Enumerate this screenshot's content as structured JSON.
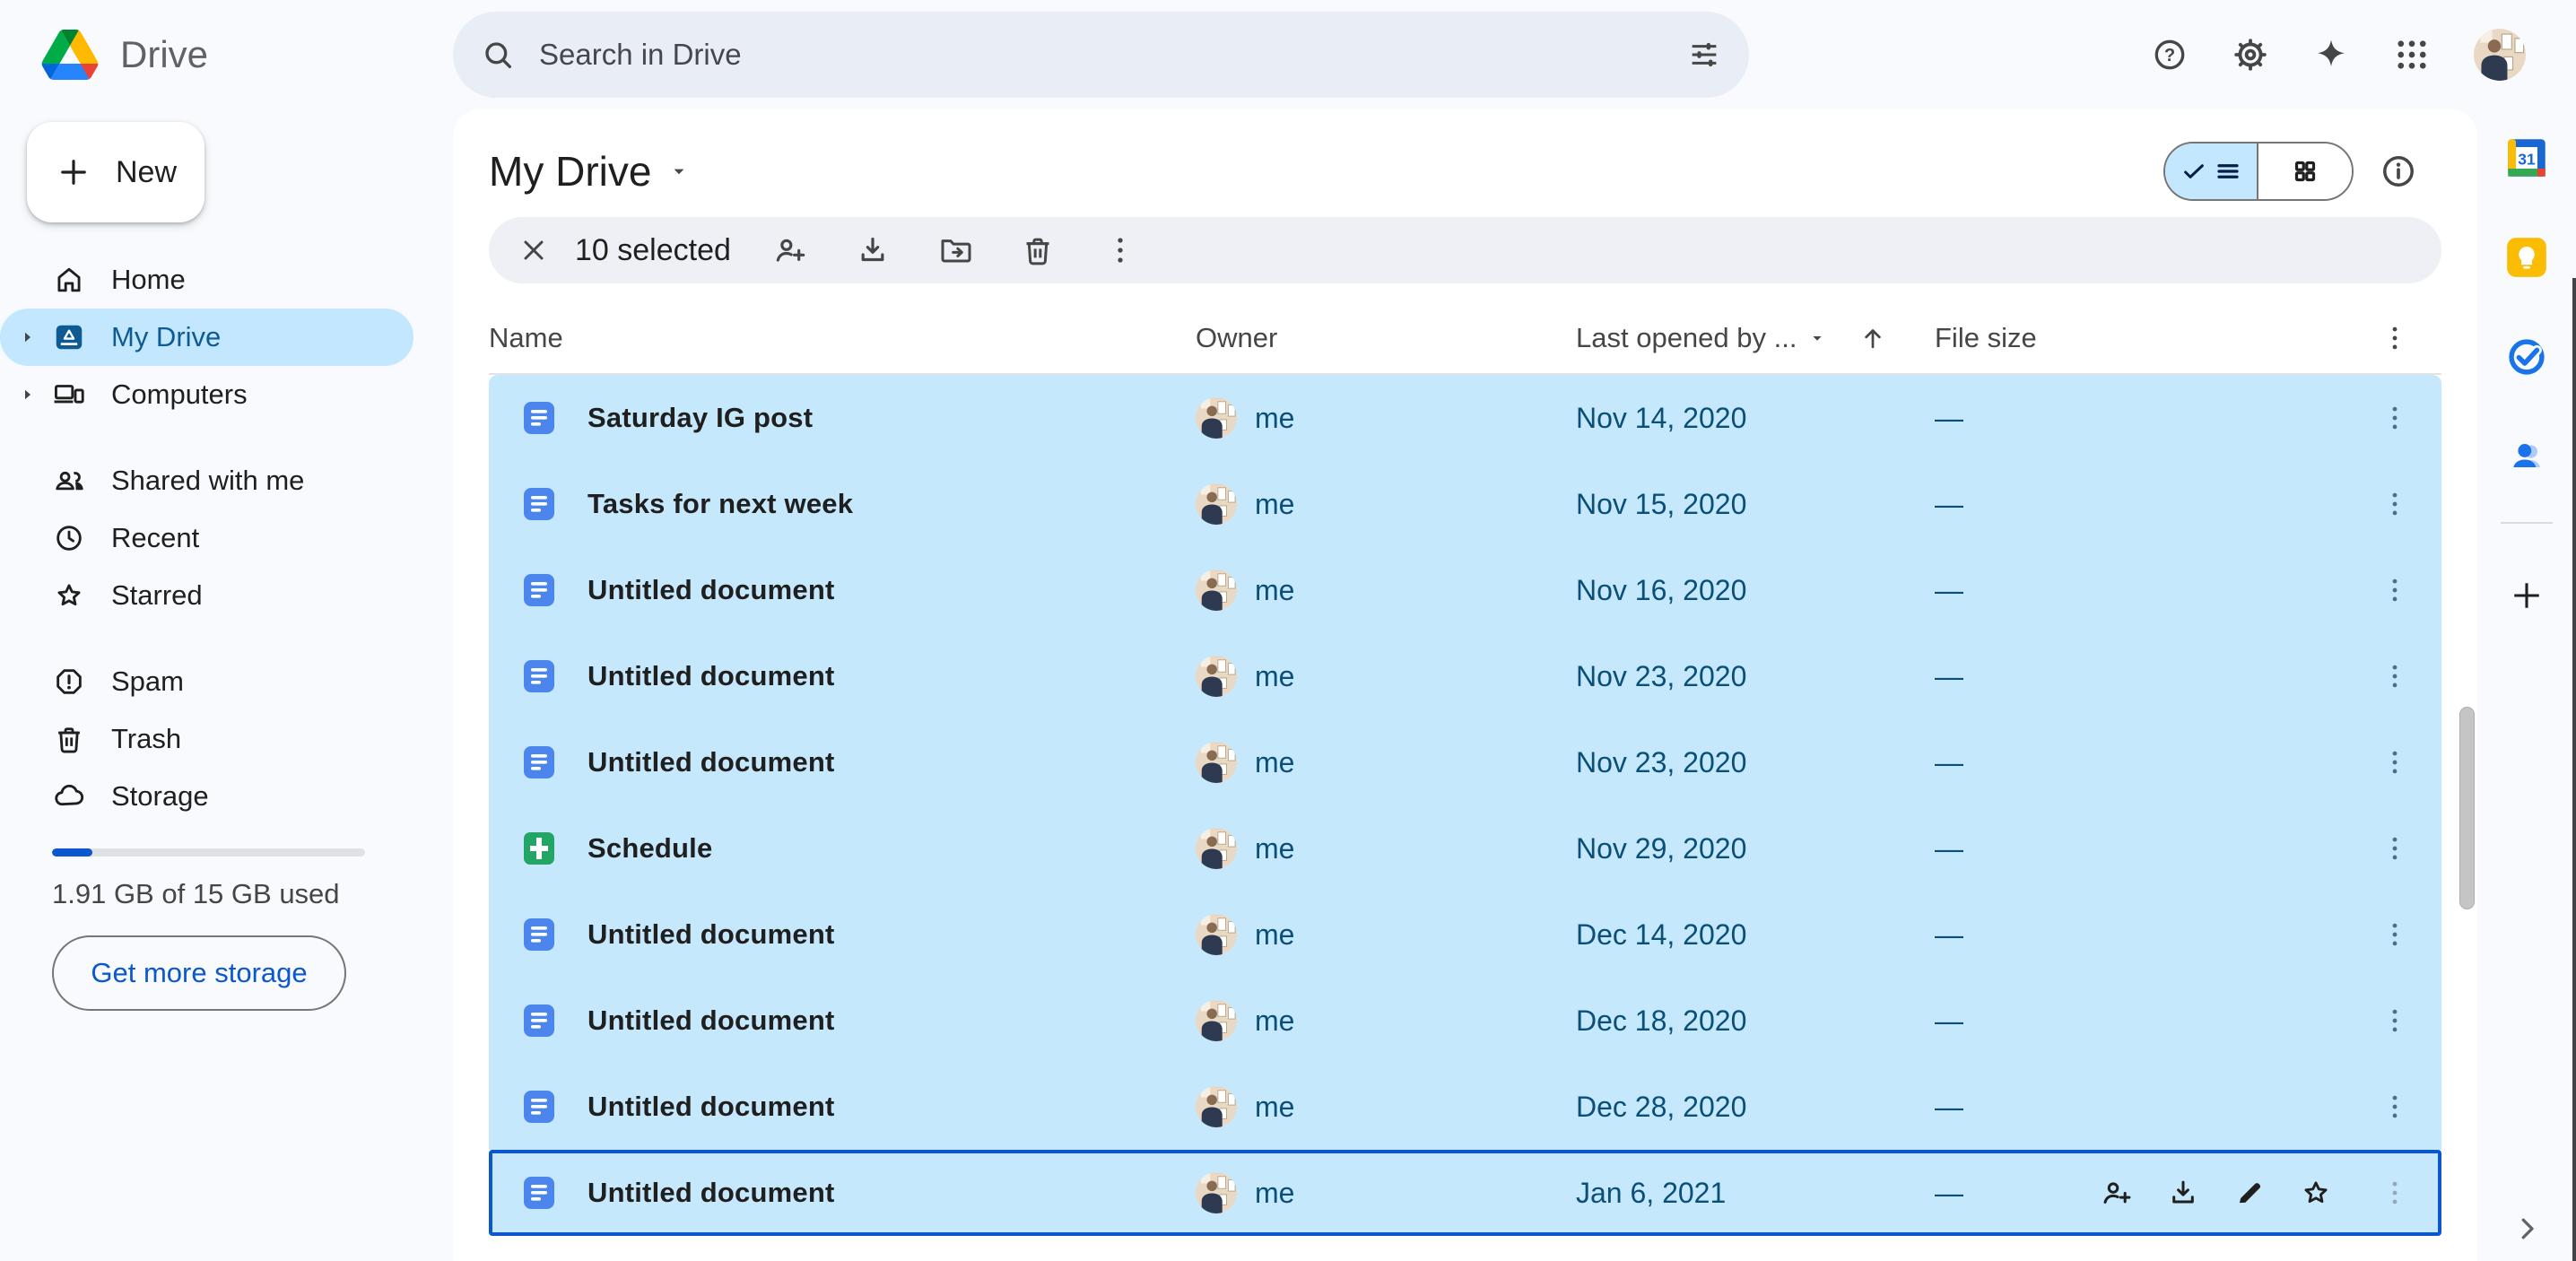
{
  "topbar": {
    "product_name": "Drive",
    "search": {
      "placeholder": "Search in Drive"
    },
    "help_glyph": "?",
    "icons": [
      "search",
      "tune",
      "help",
      "settings",
      "gemini-sparkle",
      "google-apps",
      "account-avatar"
    ]
  },
  "sidebar": {
    "new_button": "New",
    "nav_primary": [
      {
        "label": "Home",
        "icon": "home",
        "selected": false
      },
      {
        "label": "My Drive",
        "icon": "my-drive",
        "selected": true
      },
      {
        "label": "Computers",
        "icon": "computers",
        "selected": false
      }
    ],
    "nav_secondary": [
      {
        "label": "Shared with me",
        "icon": "people"
      },
      {
        "label": "Recent",
        "icon": "clock"
      },
      {
        "label": "Starred",
        "icon": "star"
      }
    ],
    "nav_tertiary": [
      {
        "label": "Spam",
        "icon": "spam"
      },
      {
        "label": "Trash",
        "icon": "trash"
      },
      {
        "label": "Storage",
        "icon": "cloud"
      }
    ],
    "storage": {
      "used_percent": 13,
      "usage_text": "1.91 GB of 15 GB used",
      "cta_label": "Get more storage"
    }
  },
  "main": {
    "title": "My Drive",
    "view_toggle": {
      "active": "list",
      "options": [
        "list",
        "grid"
      ]
    },
    "selection_toolbar": {
      "selected_text": "10 selected",
      "actions": [
        "close",
        "share",
        "download",
        "move",
        "trash",
        "more"
      ]
    },
    "table": {
      "columns": {
        "name": "Name",
        "owner": "Owner",
        "last_opened": "Last opened by ...",
        "file_size": "File size"
      },
      "sort": {
        "column": "last_opened",
        "direction": "ascending"
      },
      "rows": [
        {
          "name": "Saturday IG post",
          "type": "doc",
          "owner": "me",
          "last_opened": "Nov 14, 2020",
          "file_size": "—",
          "selected": true,
          "focused": false
        },
        {
          "name": "Tasks for next week",
          "type": "doc",
          "owner": "me",
          "last_opened": "Nov 15, 2020",
          "file_size": "—",
          "selected": true,
          "focused": false
        },
        {
          "name": "Untitled document",
          "type": "doc",
          "owner": "me",
          "last_opened": "Nov 16, 2020",
          "file_size": "—",
          "selected": true,
          "focused": false
        },
        {
          "name": "Untitled document",
          "type": "doc",
          "owner": "me",
          "last_opened": "Nov 23, 2020",
          "file_size": "—",
          "selected": true,
          "focused": false
        },
        {
          "name": "Untitled document",
          "type": "doc",
          "owner": "me",
          "last_opened": "Nov 23, 2020",
          "file_size": "—",
          "selected": true,
          "focused": false
        },
        {
          "name": "Schedule",
          "type": "sheet",
          "owner": "me",
          "last_opened": "Nov 29, 2020",
          "file_size": "—",
          "selected": true,
          "focused": false
        },
        {
          "name": "Untitled document",
          "type": "doc",
          "owner": "me",
          "last_opened": "Dec 14, 2020",
          "file_size": "—",
          "selected": true,
          "focused": false
        },
        {
          "name": "Untitled document",
          "type": "doc",
          "owner": "me",
          "last_opened": "Dec 18, 2020",
          "file_size": "—",
          "selected": true,
          "focused": false
        },
        {
          "name": "Untitled document",
          "type": "doc",
          "owner": "me",
          "last_opened": "Dec 28, 2020",
          "file_size": "—",
          "selected": true,
          "focused": false
        },
        {
          "name": "Untitled document",
          "type": "doc",
          "owner": "me",
          "last_opened": "Jan 6, 2021",
          "file_size": "—",
          "selected": true,
          "focused": true,
          "hover_actions": [
            "share",
            "download",
            "rename",
            "star",
            "more"
          ]
        }
      ]
    }
  },
  "side_panel": {
    "calendar_label": "31",
    "apps": [
      "calendar",
      "keep",
      "tasks",
      "contacts"
    ],
    "extras": [
      "get-add-ons",
      "collapse"
    ]
  },
  "colors": {
    "window_background": "#f8fafd",
    "accent_blue": "#0b57d0",
    "selection_row_background": "#c6e8fc",
    "selection_pill_background": "#c2e7ff",
    "selection_text": "#0a4f78",
    "doc_icon_blue": "#4285f4",
    "sheet_icon_green": "#23a566",
    "search_background": "#e9eef6",
    "toolbar_background": "#eef0f6"
  }
}
